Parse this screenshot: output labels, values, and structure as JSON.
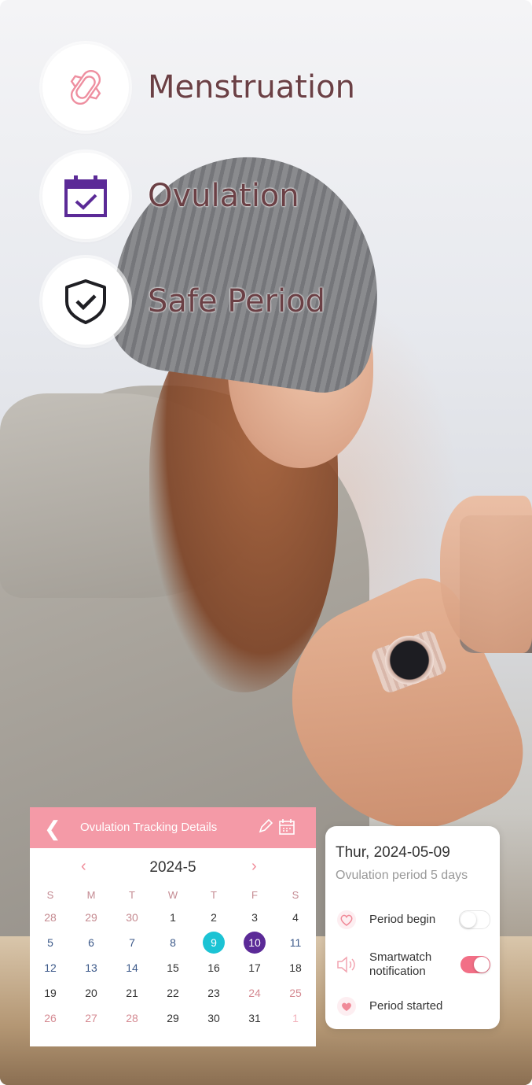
{
  "features": [
    {
      "label": "Menstruation",
      "icon": "sanitary-pad-icon"
    },
    {
      "label": "Ovulation",
      "icon": "calendar-check-icon"
    },
    {
      "label": "Safe Period",
      "icon": "shield-check-icon"
    }
  ],
  "calendar": {
    "title": "Ovulation Tracking Details",
    "month": "2024-5",
    "weekdays": [
      "S",
      "M",
      "T",
      "W",
      "T",
      "F",
      "S"
    ],
    "weeks": [
      [
        "28",
        "29",
        "30",
        "1",
        "2",
        "3",
        "4"
      ],
      [
        "5",
        "6",
        "7",
        "8",
        "9",
        "10",
        "11"
      ],
      [
        "12",
        "13",
        "14",
        "15",
        "16",
        "17",
        "18"
      ],
      [
        "19",
        "20",
        "21",
        "22",
        "23",
        "24",
        "25"
      ],
      [
        "26",
        "27",
        "28",
        "29",
        "30",
        "31",
        "1"
      ]
    ],
    "today": "9",
    "selected": "10"
  },
  "detail": {
    "date": "Thur, 2024-05-09",
    "subtitle": "Ovulation period 5 days",
    "rows": [
      {
        "label": "Period begin",
        "toggle": "off"
      },
      {
        "label": "Smartwatch notification",
        "toggle": "on"
      },
      {
        "label": "Period started"
      }
    ]
  },
  "colors": {
    "header_pink": "#f49aa7",
    "today_cyan": "#1cc3d4",
    "selected_purple": "#5b2a97",
    "toggle_on": "#f26f86",
    "feature_text": "#6b4045"
  }
}
